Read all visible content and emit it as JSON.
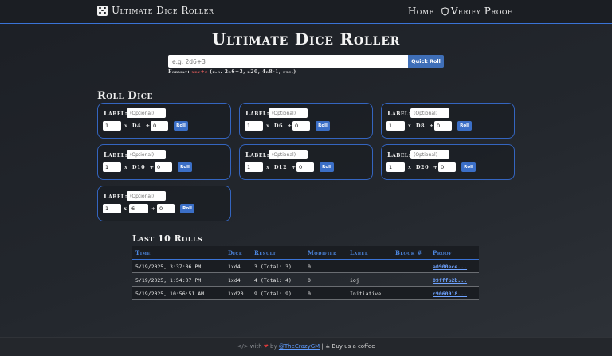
{
  "header": {
    "brand": "Ultimate Dice Roller",
    "nav": {
      "home": "Home",
      "verify": "Verify Proof"
    }
  },
  "title": "Ultimate Dice Roller",
  "quick_roll": {
    "placeholder": "e.g. 2d6+3",
    "button": "Quick Roll",
    "format_label": "Format:",
    "format_code": "xdy+z",
    "format_examples": "(e.g. 2d6+3, d20, 4d8-1, etc.)"
  },
  "roll_dice": {
    "title": "Roll Dice",
    "panels": [
      {
        "label": "Label:",
        "placeholder": "(Optional)",
        "count": "1",
        "x": "x",
        "die": "D4",
        "plus": "+",
        "modifier": "0",
        "button": "Roll"
      },
      {
        "label": "Label:",
        "placeholder": "(Optional)",
        "count": "1",
        "x": "x",
        "die": "D6",
        "plus": "+",
        "modifier": "0",
        "button": "Roll"
      },
      {
        "label": "Label:",
        "placeholder": "(Optional)",
        "count": "1",
        "x": "x",
        "die": "D8",
        "plus": "+",
        "modifier": "0",
        "button": "Roll"
      },
      {
        "label": "Label:",
        "placeholder": "(Optional)",
        "count": "1",
        "x": "x",
        "die": "D10",
        "plus": "+",
        "modifier": "0",
        "button": "Roll"
      },
      {
        "label": "Label:",
        "placeholder": "(Optional)",
        "count": "1",
        "x": "x",
        "die": "D12",
        "plus": "+",
        "modifier": "0",
        "button": "Roll"
      },
      {
        "label": "Label:",
        "placeholder": "(Optional)",
        "count": "1",
        "x": "x",
        "die": "D20",
        "plus": "+",
        "modifier": "0",
        "button": "Roll"
      },
      {
        "label": "Label:",
        "placeholder": "(Optional)",
        "count": "1",
        "x": "x",
        "sides": "6",
        "plus": "+",
        "modifier": "0",
        "button": "Roll"
      }
    ]
  },
  "history": {
    "title": "Last 10 Rolls",
    "columns": [
      "Time",
      "Dice",
      "Result",
      "Modifier",
      "Label",
      "Block #",
      "Proof"
    ],
    "rows": [
      {
        "time": "5/19/2025, 3:37:06 PM",
        "dice": "1xd4",
        "result": "3 (Total: 3)",
        "modifier": "0",
        "label": "",
        "block": "",
        "proof": "a0900ece..."
      },
      {
        "time": "5/19/2025, 1:54:07 PM",
        "dice": "1xd4",
        "result": "4 (Total: 4)",
        "modifier": "0",
        "label": "ioj",
        "block": "",
        "proof": "09fffb2b..."
      },
      {
        "time": "5/19/2025, 10:56:51 AM",
        "dice": "1xd20",
        "result": "9 (Total: 9)",
        "modifier": "0",
        "label": "Initiative",
        "block": "",
        "proof": "c9060918..."
      }
    ]
  },
  "footer": {
    "code_icon": "</>",
    "with": "with",
    "by": "by",
    "author": "@TheCrazyGM",
    "separator": "|",
    "coffee": "Buy us a coffee"
  },
  "colors": {
    "accent": "#3a73d6",
    "link": "#6fa3ff",
    "heart": "#e03b3b"
  }
}
